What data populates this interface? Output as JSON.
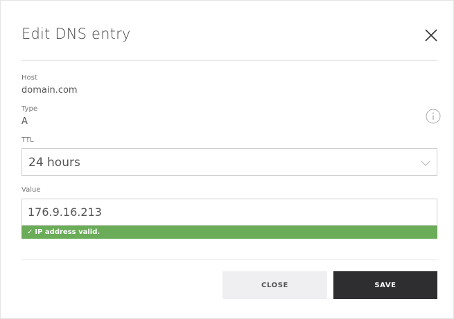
{
  "dialog": {
    "title": "Edit DNS entry",
    "close_icon": "close-icon"
  },
  "fields": {
    "host": {
      "label": "Host",
      "value": "domain.com"
    },
    "type": {
      "label": "Type",
      "value": "A",
      "info_icon": "info-icon"
    },
    "ttl": {
      "label": "TTL",
      "selected": "24 hours"
    },
    "value": {
      "label": "Value",
      "input_value": "176.9.16.213"
    }
  },
  "validation": {
    "icon": "check-icon",
    "message": "IP address valid.",
    "color": "#6aac58"
  },
  "buttons": {
    "close_label": "CLOSE",
    "save_label": "SAVE"
  }
}
